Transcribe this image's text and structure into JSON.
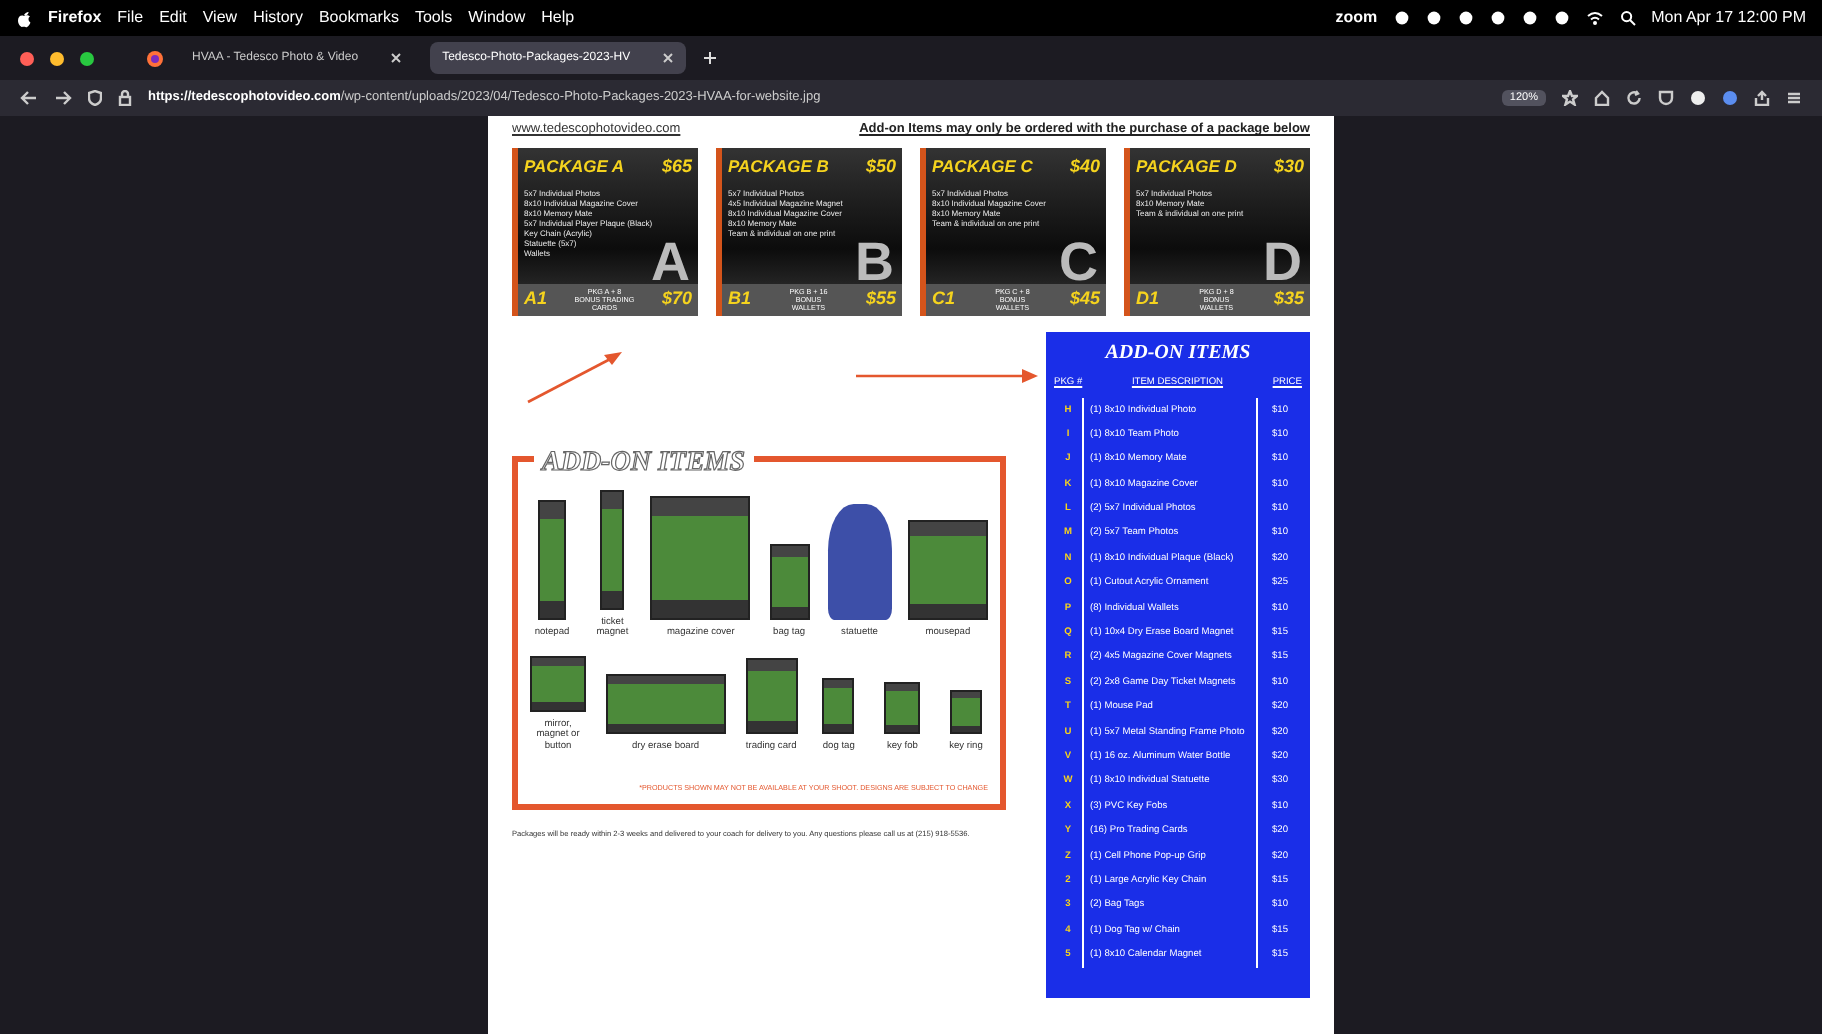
{
  "menubar": {
    "app": "Firefox",
    "menus": [
      "File",
      "Edit",
      "View",
      "History",
      "Bookmarks",
      "Tools",
      "Window",
      "Help"
    ],
    "zoom_label": "zoom",
    "clock": "Mon Apr 17  12:00 PM"
  },
  "tabs": [
    {
      "title": "HVAA - Tedesco Photo & Video",
      "selected": false
    },
    {
      "title": "Tedesco-Photo-Packages-2023-HV",
      "selected": true
    }
  ],
  "address_bar": {
    "url_host": "https://tedescophotovideo.com",
    "url_path": "/wp-content/uploads/2023/04/Tedesco-Photo-Packages-2023-HVAA-for-website.jpg",
    "zoom": "120%"
  },
  "document": {
    "website": "www.tedescophotovideo.com",
    "notice": "Add-on Items may only be ordered with the purchase of a package below",
    "packages": [
      {
        "name": "PACKAGE A",
        "price": "$65",
        "letter": "A",
        "features": [
          "5x7 Individual Photos",
          "8x10 Individual Magazine Cover",
          "8x10 Memory Mate",
          "5x7 Individual Player Plaque (Black)",
          "Key Chain (Acrylic)",
          "Statuette (5x7)",
          "Wallets"
        ],
        "bonus_code": "A1",
        "bonus_desc": "PKG A + 8 BONUS TRADING CARDS",
        "bonus_price": "$70"
      },
      {
        "name": "PACKAGE B",
        "price": "$50",
        "letter": "B",
        "features": [
          "5x7 Individual Photos",
          "4x5 Individual Magazine Magnet",
          "8x10 Individual Magazine Cover",
          "8x10 Memory Mate",
          "Team & individual on one print"
        ],
        "bonus_code": "B1",
        "bonus_desc": "PKG B + 16 BONUS WALLETS",
        "bonus_price": "$55"
      },
      {
        "name": "PACKAGE C",
        "price": "$40",
        "letter": "C",
        "features": [
          "5x7 Individual Photos",
          "8x10 Individual Magazine Cover",
          "8x10 Memory Mate",
          "Team & individual on one print"
        ],
        "bonus_code": "C1",
        "bonus_desc": "PKG C + 8 BONUS WALLETS",
        "bonus_price": "$45"
      },
      {
        "name": "PACKAGE D",
        "price": "$30",
        "letter": "D",
        "features": [
          "5x7 Individual Photos",
          "8x10 Memory Mate",
          "Team & individual on one print"
        ],
        "bonus_code": "D1",
        "bonus_desc": "PKG D + 8 BONUS WALLETS",
        "bonus_price": "$35"
      }
    ],
    "addon_graphic": {
      "title": "ADD-ON ITEMS",
      "top_row": [
        "notepad",
        "ticket magnet",
        "magazine cover",
        "bag tag",
        "statuette",
        "mousepad"
      ],
      "bottom_row": [
        "mirror, magnet or button",
        "dry erase board",
        "trading card",
        "dog tag",
        "key fob",
        "key ring"
      ],
      "disclaimer": "*PRODUCTS SHOWN MAY NOT BE AVAILABLE AT YOUR SHOOT. DESIGNS ARE SUBJECT TO CHANGE"
    },
    "footer": "Packages will be ready within 2-3 weeks and delivered to your coach for delivery to you.  Any questions please call us at (215) 918-5536.",
    "addon_table": {
      "title": "ADD-ON ITEMS",
      "columns": [
        "PKG #",
        "ITEM DESCRIPTION",
        "PRICE"
      ],
      "rows": [
        {
          "code": "H",
          "item": "(1) 8x10 Individual Photo",
          "price": "$10"
        },
        {
          "code": "I",
          "item": "(1) 8x10 Team Photo",
          "price": "$10"
        },
        {
          "code": "J",
          "item": "(1) 8x10 Memory Mate",
          "price": "$10"
        },
        {
          "code": "K",
          "item": "(1) 8x10 Magazine Cover",
          "price": "$10"
        },
        {
          "code": "L",
          "item": "(2) 5x7 Individual Photos",
          "price": "$10"
        },
        {
          "code": "M",
          "item": "(2) 5x7 Team Photos",
          "price": "$10"
        },
        {
          "code": "N",
          "item": "(1) 8x10 Individual Plaque (Black)",
          "price": "$20"
        },
        {
          "code": "O",
          "item": "(1) Cutout Acrylic Ornament",
          "price": "$25"
        },
        {
          "code": "P",
          "item": "(8) Individual Wallets",
          "price": "$10"
        },
        {
          "code": "Q",
          "item": "(1) 10x4 Dry Erase Board Magnet",
          "price": "$15"
        },
        {
          "code": "R",
          "item": "(2) 4x5 Magazine Cover Magnets",
          "price": "$15"
        },
        {
          "code": "S",
          "item": "(2) 2x8 Game Day Ticket Magnets",
          "price": "$10"
        },
        {
          "code": "T",
          "item": "(1) Mouse Pad",
          "price": "$20"
        },
        {
          "code": "U",
          "item": "(1) 5x7 Metal Standing Frame Photo",
          "price": "$20"
        },
        {
          "code": "V",
          "item": "(1) 16 oz. Aluminum Water Bottle",
          "price": "$20"
        },
        {
          "code": "W",
          "item": "(1) 8x10 Individual Statuette",
          "price": "$30"
        },
        {
          "code": "X",
          "item": "(3) PVC Key Fobs",
          "price": "$10"
        },
        {
          "code": "Y",
          "item": "(16) Pro Trading Cards",
          "price": "$20"
        },
        {
          "code": "Z",
          "item": "(1) Cell Phone Pop-up Grip",
          "price": "$20"
        },
        {
          "code": "2",
          "item": "(1) Large Acrylic Key Chain",
          "price": "$15"
        },
        {
          "code": "3",
          "item": "(2) Bag Tags",
          "price": "$10"
        },
        {
          "code": "4",
          "item": "(1) Dog Tag w/ Chain",
          "price": "$15"
        },
        {
          "code": "5",
          "item": "(1) 8x10 Calendar Magnet",
          "price": "$15"
        }
      ]
    }
  }
}
